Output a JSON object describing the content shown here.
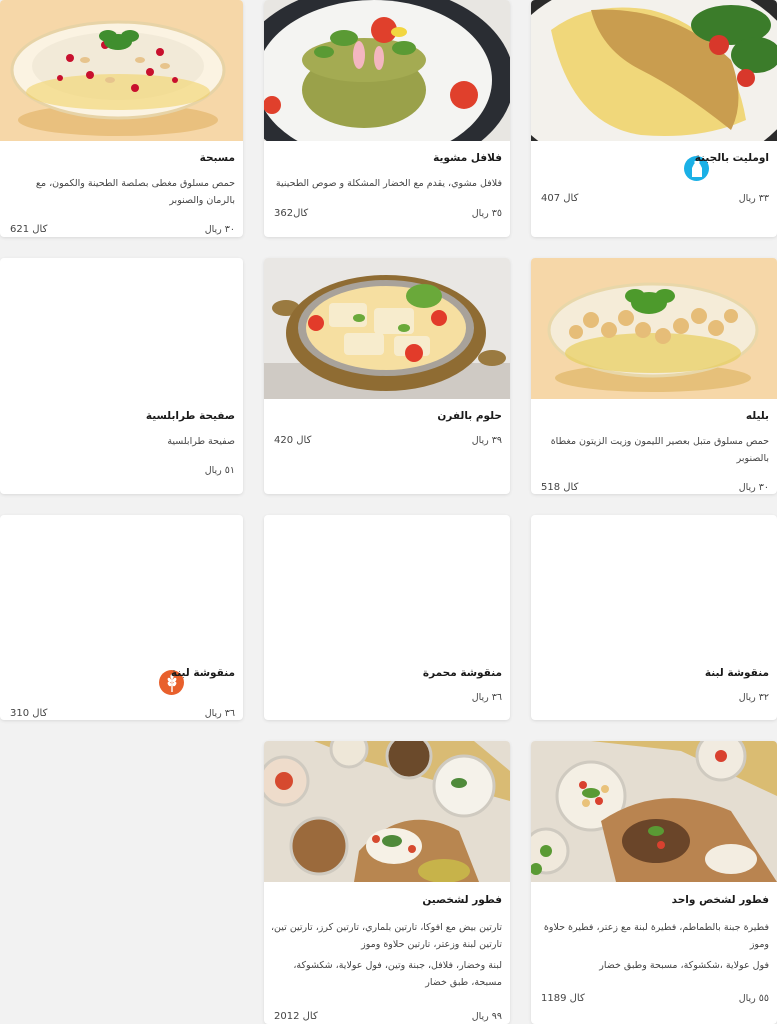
{
  "items": [
    {
      "title": "مسبحة",
      "desc": [
        "حمص مسلوق مغطى بصلصة الطحينة والكمون، مع بالرمان والصنوبر"
      ],
      "price": "٣٠ ريال",
      "calories": "621 كال",
      "image": "msabbaha-bowl"
    },
    {
      "title": "فلافل مشوية",
      "desc": [
        "فلافل مشوي، يقدم مع الخضار المشكلة و صوص الطحينية"
      ],
      "price": "٣٥ ريال",
      "calories": "362كال",
      "image": "grilled-falafel-plate"
    },
    {
      "title": "اومليت بالجبنة",
      "desc": [],
      "price": "٣٣ ريال",
      "calories": "407 كال",
      "image": "cheese-omelette-plate",
      "badge": "milk-bottle-icon",
      "badge_color": "#1ab0e6"
    },
    {
      "title": "صفيحة طرابلسية",
      "desc": [
        "صفيحة طرابلسية"
      ],
      "price": "٥١ ريال",
      "calories": "",
      "image": ""
    },
    {
      "title": "حلوم بالفرن",
      "desc": [],
      "price": "٣٩ ريال",
      "calories": "420 كال",
      "image": "baked-halloumi-pan"
    },
    {
      "title": "بليله",
      "desc": [
        "حمص مسلوق متبل بعصير الليمون وزيت الزيتون مغطاة بالصنوبر"
      ],
      "price": "٣٠ ريال",
      "calories": "518 كال",
      "image": "balila-bowl"
    },
    {
      "title": "منقوشة لبنة",
      "desc": [],
      "price": "٣٦ ريال",
      "calories": "310 كال",
      "image": "",
      "badge": "wheat-icon",
      "badge_color": "#e8602c"
    },
    {
      "title": "منقوشة محمرة",
      "desc": [],
      "price": "٣٦ ريال",
      "calories": "",
      "image": ""
    },
    {
      "title": "منقوشة لبنة",
      "desc": [],
      "price": "٣٢ ريال",
      "calories": "",
      "image": ""
    },
    {
      "title": "فطور لشخصين",
      "desc": [
        "تارتين بيض مع افوكا، تارتين بلماري، تارتين كرز، تارتين تين، تارتين لبنة وزعتر، تارتين حلاوة وموز",
        "لبنة وخضار، فلافل، جبنة وتين، فول عولاية، شكشوكة، مسبحة، طبق خضار"
      ],
      "price": "٩٩ ريال",
      "calories": "2012 كال",
      "image": "breakfast-for-two-spread"
    },
    {
      "title": "فطور لشخص واحد",
      "desc": [
        "فطيرة جبنة بالطماطم، فطيرة لبنة مع زعتر، فطيرة حلاوة وموز",
        "فول عولاية ،شكشوكة، مسبحة وطبق خضار"
      ],
      "price": "٥٥ ريال",
      "calories": "1189 كال",
      "image": "breakfast-for-one-spread"
    }
  ]
}
